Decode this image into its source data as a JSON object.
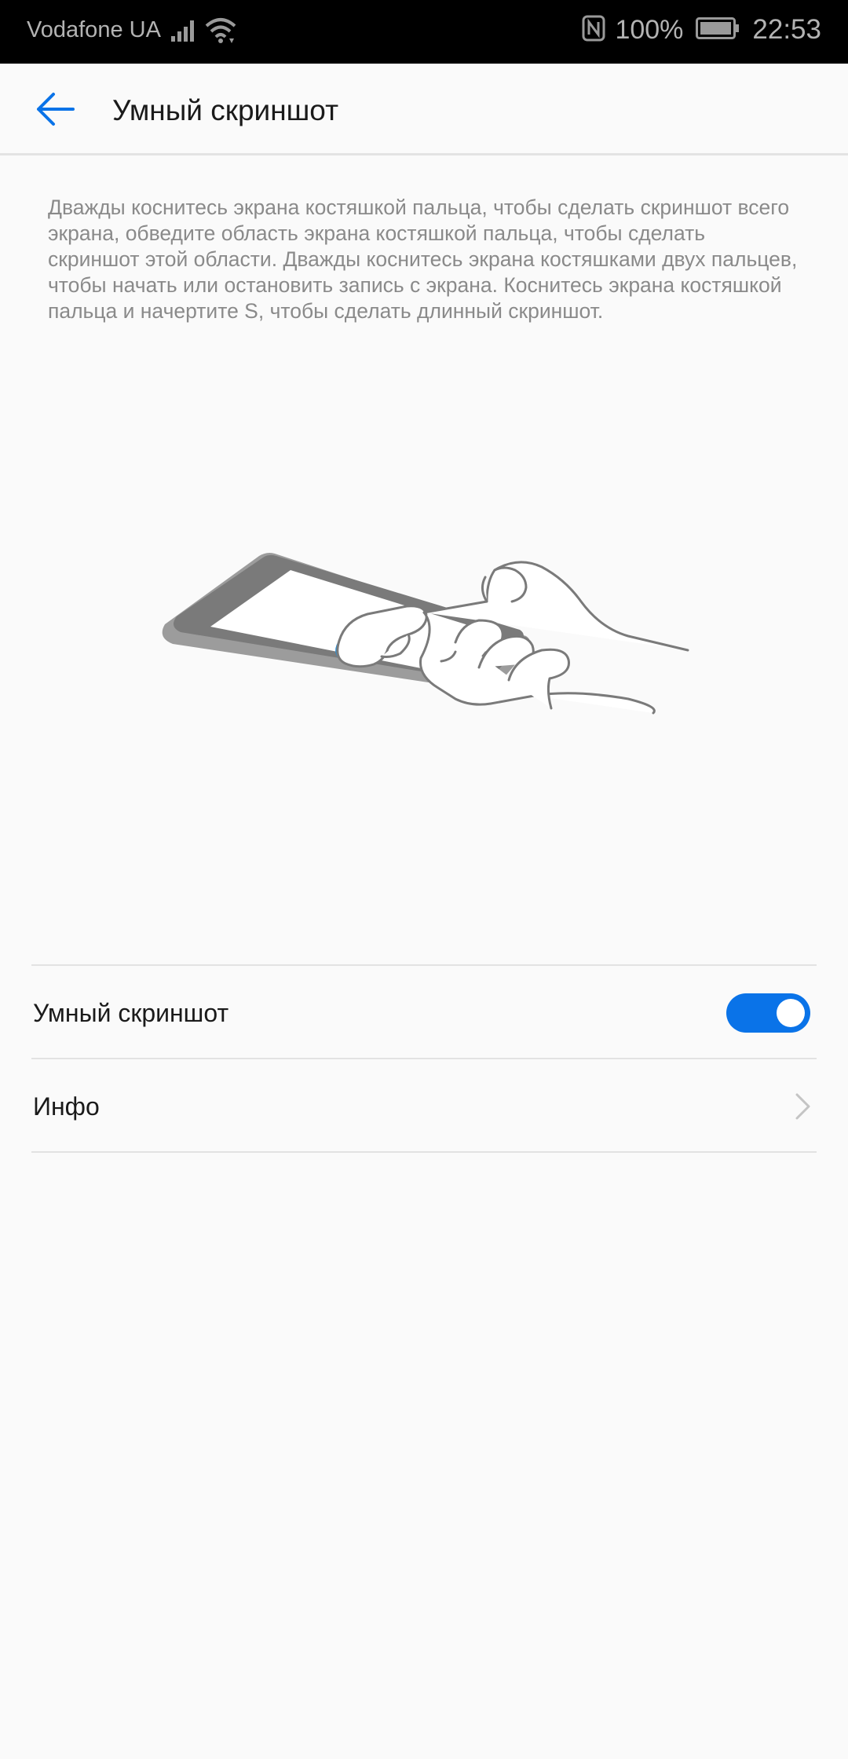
{
  "status_bar": {
    "carrier": "Vodafone UA",
    "battery_percent": "100%",
    "time": "22:53",
    "icons": [
      "signal-icon",
      "wifi-icon",
      "nfc-icon",
      "battery-icon"
    ]
  },
  "app_bar": {
    "title": "Умный скриншот",
    "back_icon": "arrow-left-icon"
  },
  "description": "Дважды коснитесь экрана костяшкой пальца, чтобы сделать скриншот всего экрана, обведите область экрана костяшкой пальца, чтобы сделать скриншот этой области. Дважды коснитесь экрана костяшками двух пальцев, чтобы начать или остановить запись с экрана. Коснитесь экрана костяшкой пальца и начертите S, чтобы сделать длинный скриншот.",
  "settings": {
    "smart_screenshot": {
      "label": "Умный скриншот",
      "enabled": true
    },
    "info": {
      "label": "Инфо",
      "icon": "chevron-right-icon"
    }
  },
  "colors": {
    "accent": "#0a73e8",
    "status_bar_bg": "#000000",
    "background": "#fafafa"
  }
}
